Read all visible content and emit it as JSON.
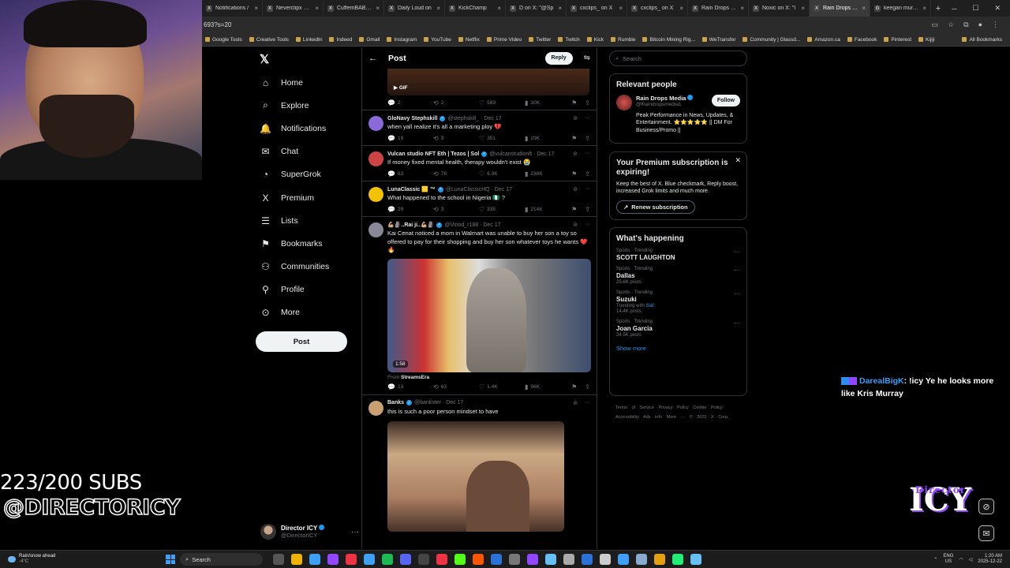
{
  "browser": {
    "tabs": [
      {
        "label": "Notifications /",
        "fav": "X"
      },
      {
        "label": "Neverclipx on X",
        "fav": "X"
      },
      {
        "label": "CuffemBABY o",
        "fav": "X"
      },
      {
        "label": "Daily Loud on",
        "fav": "X"
      },
      {
        "label": "KickChamp",
        "fav": "X"
      },
      {
        "label": "D on X: \"@Sp",
        "fav": "X"
      },
      {
        "label": "cxclips_ on X",
        "fav": "X"
      },
      {
        "label": "cxclips_ on X",
        "fav": "X"
      },
      {
        "label": "Rain Drops Me",
        "fav": "X"
      },
      {
        "label": "Noxic on X: \"I",
        "fav": "X"
      },
      {
        "label": "Rain Drops Me",
        "fav": "X",
        "active": true
      },
      {
        "label": "keegan murray",
        "fav": "G"
      }
    ],
    "url": "693?s=20",
    "bookmarks": [
      "Google Tools",
      "Creative Tools",
      "LinkedIn",
      "Indeed",
      "Gmail",
      "Instagram",
      "YouTube",
      "Netflix",
      "Prime Video",
      "Twitter",
      "Twitch",
      "Kick",
      "Rumble",
      "Bitcoin Mining Rig...",
      "WeTransfer",
      "Community | Glassd...",
      "Amazon.ca",
      "Facebook",
      "Pinterest",
      "Kijiji"
    ],
    "all_bookmarks": "All Bookmarks"
  },
  "overlay": {
    "subs": "223/200 SUBS",
    "handle": "@DIRECTORICY",
    "chat_user": "DarealBigK",
    "chat_text": ": !icy Ye he looks more like Kris Murray",
    "logo_small": "Director",
    "logo_big": "ICY"
  },
  "nav": {
    "items": [
      {
        "label": "Home",
        "icon": "⌂"
      },
      {
        "label": "Explore",
        "icon": "⌕"
      },
      {
        "label": "Notifications",
        "icon": "🔔"
      },
      {
        "label": "Chat",
        "icon": "✉"
      },
      {
        "label": "SuperGrok",
        "icon": "◔"
      },
      {
        "label": "Premium",
        "icon": "X"
      },
      {
        "label": "Lists",
        "icon": "☰"
      },
      {
        "label": "Bookmarks",
        "icon": "⚑"
      },
      {
        "label": "Communities",
        "icon": "⚇"
      },
      {
        "label": "Profile",
        "icon": "⚲"
      },
      {
        "label": "More",
        "icon": "⊙"
      }
    ],
    "post_label": "Post",
    "account_name": "Director ICY",
    "account_handle": "@DirectorICY"
  },
  "timeline": {
    "title": "Post",
    "reply_label": "Reply",
    "top": {
      "gif_label": "GIF",
      "replies": "2",
      "reposts": "2",
      "likes": "589",
      "views": "30K"
    },
    "tweets": [
      {
        "name": "GloNavy Stephskill",
        "handle": "@stephskill_ · Dec 17",
        "text": "when yall realize it's all a marketing ploy 💔",
        "replies": "19",
        "reposts": "3",
        "likes": "351",
        "views": "29K"
      },
      {
        "name": "Vulcan studio NFT Eth | Tezos | Sol",
        "handle": "@vulcanstudionft · Dec 17",
        "text": "If money fixed mental health, therapy wouldn't exist 😭",
        "replies": "63",
        "reposts": "76",
        "likes": "6.3K",
        "views": "238K"
      },
      {
        "name": "LunaClassic 🟨 ™",
        "handle": "@LunaClassicHQ · Dec 17",
        "text": "What happened to the school in Nigeria 🇳🇬 ?",
        "replies": "29",
        "reposts": "3",
        "likes": "335",
        "views": "214K"
      },
      {
        "name": "💪🏼🗿..Rai ji..💪🏼🗿",
        "handle": "@Vinod_r188 · Dec 17",
        "text": "Kai Cenat noticed a mom in Walmart was unable to buy her son a toy so offered to pay for their shopping and buy her son whatever toys he wants ❤️🔥",
        "duration": "1:58",
        "from_label": "From",
        "from_source": "StreamsEra",
        "replies": "13",
        "reposts": "63",
        "likes": "1.4K",
        "views": "96K"
      },
      {
        "name": "Banks",
        "handle": "@bankster · Dec 17",
        "text": "this is such a poor person mindset to have"
      }
    ]
  },
  "sidebar": {
    "search_placeholder": "Search",
    "relevant_title": "Relevant people",
    "person_name": "Rain Drops Media",
    "person_handle": "@Raindropsmedia1",
    "follow_label": "Follow",
    "person_bio": "Peak Performance in News, Updates, & Entertainment. ⭐⭐⭐⭐⭐ || DM For Business/Promo ||",
    "premium_title": "Your Premium subscription is expiring!",
    "premium_desc": "Keep the best of X. Blue checkmark, Reply boost, increased Grok limits and much more.",
    "renew_label": "Renew subscription",
    "happening_title": "What's happening",
    "trends": [
      {
        "category": "Sports · Trending",
        "name": "SCOTT LAUGHTON",
        "sub": "",
        "sub_link": "",
        "posts": ""
      },
      {
        "category": "Sports · Trending",
        "name": "Dallas",
        "sub": "",
        "sub_link": "",
        "posts": "25.6K posts"
      },
      {
        "category": "Sports · Trending",
        "name": "Suzuki",
        "sub": "Trending with",
        "sub_link": "Slaf",
        "posts": "14.4K posts"
      },
      {
        "category": "Sports · Trending",
        "name": "Joan Garcia",
        "sub": "",
        "sub_link": "",
        "posts": "34.5K posts"
      }
    ],
    "show_more": "Show more",
    "footer": "Terms of Service  Privacy Policy  Cookie Policy  Accessibility  Ads info  More ···  © 2025 X Corp."
  },
  "taskbar": {
    "weather_title": "Rain/snow ahead",
    "weather_temp": "-4°C",
    "search_label": "Search",
    "lang": "ENG",
    "region": "US",
    "time": "1:20 AM",
    "date": "2025-12-22"
  }
}
